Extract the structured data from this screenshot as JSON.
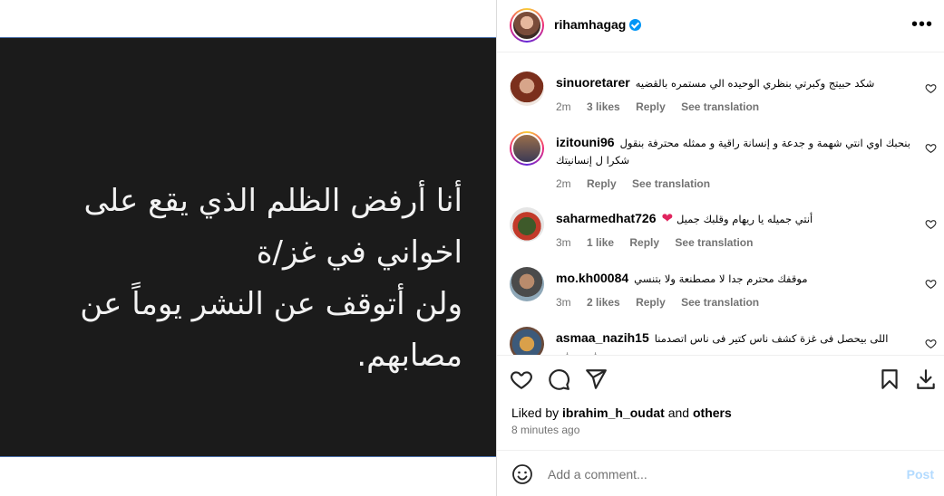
{
  "post": {
    "media_text_lines": [
      "أنا أرفض الظلم الذي يقع على",
      "اخواني في غز/ة",
      "ولن أتوقف عن النشر يوماً عن",
      "مصابهم."
    ]
  },
  "header": {
    "username": "rihamhagag",
    "more_icon": "more-horizontal-icon"
  },
  "comments": [
    {
      "username": "sinuoretarer",
      "text": "شكد حبيتج وكبرتي بنظري الوحيده الي مستمره بالقضيه",
      "time": "2m",
      "likes": "3 likes",
      "reply": "Reply",
      "translate": "See translation"
    },
    {
      "username": "izitouni96",
      "text": "بنحبك اوي انتي شهمة و جدعة و إنسانة راقية و ممثله محترفة بنقول شكرا ل إنسانيتك",
      "time": "2m",
      "likes": "",
      "reply": "Reply",
      "translate": "See translation"
    },
    {
      "username": "saharmedhat726",
      "text": "أنتي جميله يا ريهام وقلبك جميل",
      "time": "3m",
      "likes": "1 like",
      "reply": "Reply",
      "translate": "See translation"
    },
    {
      "username": "mo.kh00084",
      "text": "موقفك محترم جدا لا مصطنعة ولا بتنسي",
      "time": "3m",
      "likes": "2 likes",
      "reply": "Reply",
      "translate": "See translation"
    },
    {
      "username": "asmaa_nazih15",
      "text": "اللى بيحصل فى غزة كشف ناس كتير فى ناس اتصدمنا فيهم وفي",
      "time": "",
      "likes": "",
      "reply": "",
      "translate": ""
    }
  ],
  "liked_by": {
    "prefix": "Liked by",
    "user": "ibrahim_h_oudat",
    "and": "and",
    "others": "others"
  },
  "timestamp": "8 minutes ago",
  "add_comment": {
    "placeholder": "Add a comment...",
    "post_label": "Post"
  },
  "colors": {
    "verified": "#0095f6",
    "post_disabled": "#b3dbff",
    "heart": "#e0245e"
  }
}
